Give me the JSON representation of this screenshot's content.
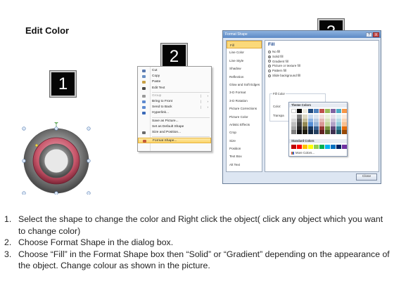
{
  "slide": {
    "title": "Edit Color"
  },
  "badges": {
    "step1": "1",
    "step2": "2",
    "step3": "3"
  },
  "ring": {
    "outer_color": "#7a7a7a",
    "inner_color": "#c8566a",
    "handle_color": "#4b9a4b"
  },
  "context_menu": {
    "items": [
      {
        "label": "Cut",
        "icon": "scissors-icon"
      },
      {
        "label": "Copy",
        "icon": "copy-icon"
      },
      {
        "label": "Paste",
        "icon": "paste-icon"
      },
      {
        "label": "Edit Text",
        "icon": "edit-text-icon"
      },
      {
        "label": "Group",
        "icon": "group-icon",
        "submenu": true,
        "disabled": true
      },
      {
        "label": "Bring to Front",
        "icon": "bring-front-icon",
        "submenu": true
      },
      {
        "label": "Send to Back",
        "icon": "send-back-icon",
        "submenu": true
      },
      {
        "label": "Hyperlink...",
        "icon": "hyperlink-icon"
      },
      {
        "label": "Save as Picture...",
        "icon": ""
      },
      {
        "label": "Set as Default Shape",
        "icon": ""
      },
      {
        "label": "Size and Position...",
        "icon": "size-icon"
      },
      {
        "label": "Format Shape...",
        "icon": "format-shape-icon",
        "highlighted": true
      }
    ]
  },
  "dialog": {
    "title": "Format Shape",
    "help_btn": "?",
    "close_btn": "X",
    "nav": [
      "Fill",
      "Line Color",
      "Line Style",
      "Shadow",
      "Reflection",
      "Glow and Soft Edges",
      "3-D Format",
      "3-D Rotation",
      "Picture Corrections",
      "Picture Color",
      "Artistic Effects",
      "Crop",
      "Size",
      "Position",
      "Text Box",
      "Alt Text"
    ],
    "active_nav": "Fill",
    "panel_heading": "Fill",
    "fill_options": [
      "No fill",
      "Solid fill",
      "Gradient fill",
      "Picture or texture fill",
      "Pattern fill",
      "Slide background fill"
    ],
    "selected_option": "Solid fill",
    "fill_color_group": "Fill Color",
    "color_label": "Color:",
    "transparency_label": "Transpa",
    "theme_colors_label": "Theme Colors",
    "standard_colors_label": "Standard Colors",
    "more_colors_label": "More Colors...",
    "close_label": "Close",
    "theme_top": [
      "#ffffff",
      "#000000",
      "#eeece1",
      "#1f497d",
      "#4f81bd",
      "#c0504d",
      "#9bbb59",
      "#8064a2",
      "#4bacc6",
      "#f79646"
    ],
    "theme_shades": [
      [
        "#f2f2f2",
        "#d9d9d9",
        "#bfbfbf",
        "#a6a6a6",
        "#808080"
      ],
      [
        "#7f7f7f",
        "#595959",
        "#404040",
        "#262626",
        "#0d0d0d"
      ],
      [
        "#ddd9c3",
        "#c4bd97",
        "#938953",
        "#494429",
        "#1d1b10"
      ],
      [
        "#c6d9f0",
        "#8db3e2",
        "#548dd4",
        "#17365d",
        "#0f243e"
      ],
      [
        "#dbe5f1",
        "#b8cce4",
        "#95b3d7",
        "#366092",
        "#244061"
      ],
      [
        "#f2dcdb",
        "#e5b9b7",
        "#d99694",
        "#953734",
        "#632423"
      ],
      [
        "#ebf1dd",
        "#d7e3bc",
        "#c3d69b",
        "#76923c",
        "#4f6128"
      ],
      [
        "#e5e0ec",
        "#ccc1d9",
        "#b2a2c7",
        "#5f497a",
        "#3f3151"
      ],
      [
        "#dbeef3",
        "#b7dde8",
        "#92cddc",
        "#31859b",
        "#205867"
      ],
      [
        "#fdeada",
        "#fbd5b5",
        "#fac08f",
        "#e36c09",
        "#974806"
      ]
    ],
    "standard": [
      "#c00000",
      "#ff0000",
      "#ffc000",
      "#ffff00",
      "#92d050",
      "#00b050",
      "#00b0f0",
      "#0070c0",
      "#002060",
      "#7030a0"
    ]
  },
  "instructions": [
    {
      "num": "1.",
      "text": "Select the shape to change the color and Right click the object( click any object which you want to change color)"
    },
    {
      "num": "2.",
      "text": "Choose Format Shape in the dialog box."
    },
    {
      "num": "3.",
      "text": "Choose “Fill” in the Format Shape box then “Solid” or “Gradient” depending on the appearance of the object. Change colour as shown in the picture."
    }
  ]
}
